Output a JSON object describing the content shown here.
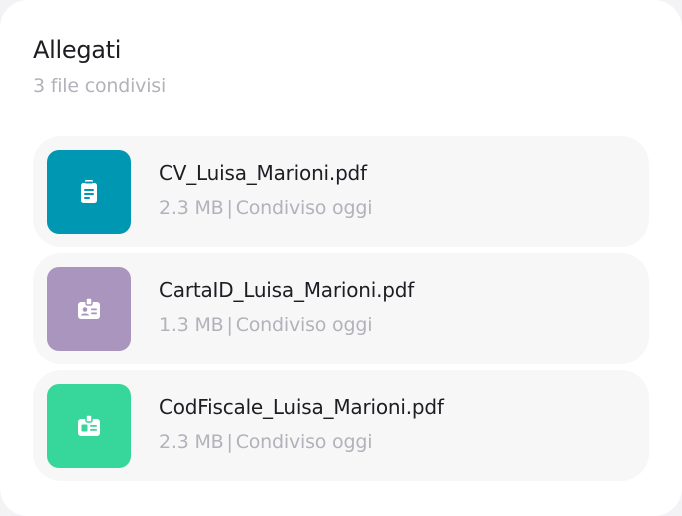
{
  "header": {
    "title": "Allegati",
    "subtitle": "3 file condivisi"
  },
  "files": [
    {
      "name": "CV_Luisa_Marioni.pdf",
      "size": "2.3 MB",
      "separator": "|",
      "shared": "Condiviso oggi",
      "icon": "clipboard-icon",
      "color": "#0097b2"
    },
    {
      "name": "CartaID_Luisa_Marioni.pdf",
      "size": "1.3 MB",
      "separator": "|",
      "shared": "Condiviso oggi",
      "icon": "id-badge-icon",
      "color": "#a995bd"
    },
    {
      "name": "CodFiscale_Luisa_Marioni.pdf",
      "size": "2.3 MB",
      "separator": "|",
      "shared": "Condiviso oggi",
      "icon": "id-card-icon",
      "color": "#37d69b"
    }
  ]
}
